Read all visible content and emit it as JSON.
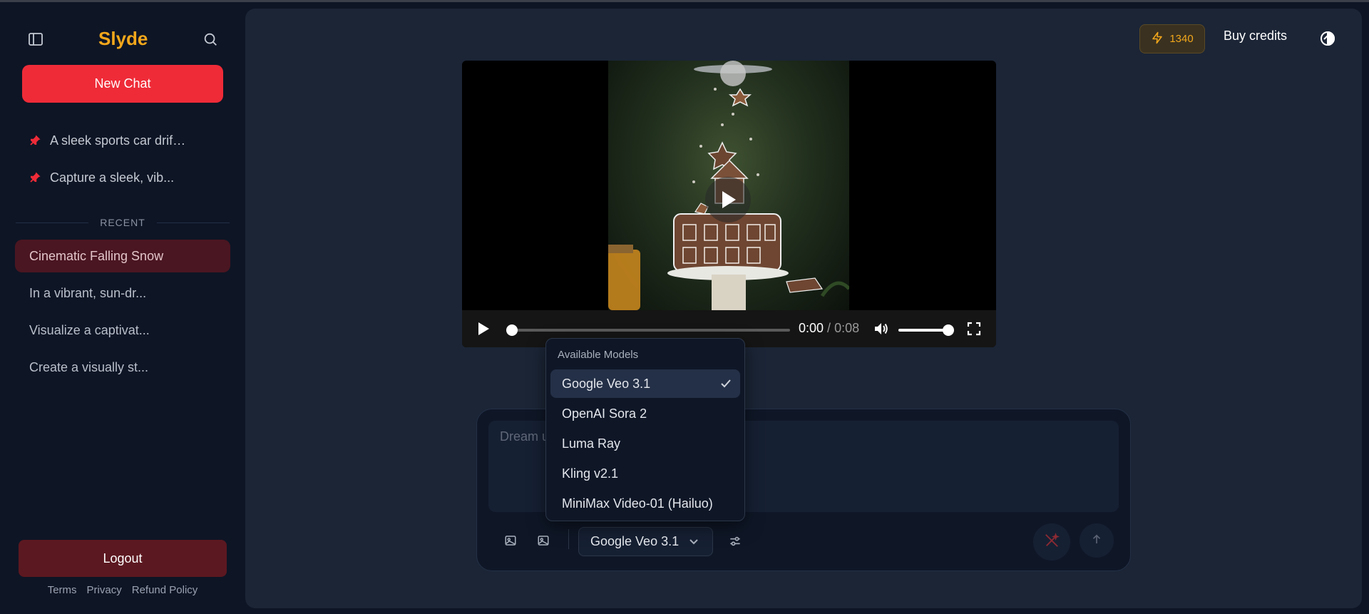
{
  "colors": {
    "brand": "#f2a71b",
    "accent_red": "#ef2b38",
    "logout_bg": "#5c1820",
    "active_item_bg": "#4a1621",
    "panel_bg": "#1b2536",
    "page_bg": "#0e1525"
  },
  "sidebar": {
    "brand": "Slyde",
    "toggle_icon": "sidebar-toggle-icon",
    "search_icon": "search-icon",
    "new_chat_label": "New Chat",
    "pinned": [
      {
        "label": "A sleek sports car drif…",
        "icon": "pin-icon"
      },
      {
        "label": "Capture a sleek, vib...",
        "icon": "pin-icon"
      }
    ],
    "recent_label": "RECENT",
    "recent": [
      {
        "label": "Cinematic Falling Snow",
        "active": true
      },
      {
        "label": "In a vibrant, sun-dr...",
        "active": false
      },
      {
        "label": "Visualize a captivat...",
        "active": false
      },
      {
        "label": "Create a visually st...",
        "active": false
      }
    ],
    "logout_label": "Logout",
    "footer_links": [
      "Terms",
      "Privacy",
      "Refund Policy"
    ]
  },
  "header": {
    "credits": "1340",
    "credits_icon": "lightning-icon",
    "buy_credits": "Buy credits",
    "theme_icon": "theme-toggle-icon"
  },
  "video": {
    "current_time": "0:00",
    "separator": " / ",
    "duration": "0:08",
    "progress": 0,
    "volume": 1.0
  },
  "dropdown": {
    "title": "Available Models",
    "models": [
      {
        "label": "Google Veo 3.1",
        "selected": true
      },
      {
        "label": "OpenAI Sora 2",
        "selected": false
      },
      {
        "label": "Luma Ray",
        "selected": false
      },
      {
        "label": "Kling v2.1",
        "selected": false
      },
      {
        "label": "MiniMax Video-01 (Hailuo)",
        "selected": false
      }
    ]
  },
  "composer": {
    "placeholder": "Dream up a video...",
    "value": "",
    "selected_model": "Google Veo 3.1"
  }
}
